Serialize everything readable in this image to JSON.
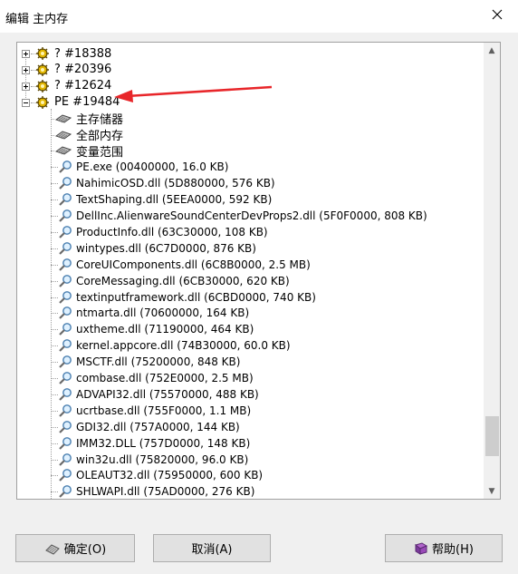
{
  "window": {
    "title": "编辑 主内存"
  },
  "tree": {
    "processes": [
      {
        "label": "? #18388",
        "expanded": false
      },
      {
        "label": "? #20396",
        "expanded": false
      },
      {
        "label": "? #12624",
        "expanded": false
      },
      {
        "label": "PE #19484",
        "expanded": true
      }
    ],
    "memory_regions": [
      "主存储器",
      "全部内存",
      "变量范围"
    ],
    "modules": [
      "PE.exe (00400000, 16.0 KB)",
      "NahimicOSD.dll (5D880000, 576 KB)",
      "TextShaping.dll (5EEA0000, 592 KB)",
      "DellInc.AlienwareSoundCenterDevProps2.dll (5F0F0000, 808 KB)",
      "ProductInfo.dll (63C30000, 108 KB)",
      "wintypes.dll (6C7D0000, 876 KB)",
      "CoreUIComponents.dll (6C8B0000, 2.5 MB)",
      "CoreMessaging.dll (6CB30000, 620 KB)",
      "textinputframework.dll (6CBD0000, 740 KB)",
      "ntmarta.dll (70600000, 164 KB)",
      "uxtheme.dll (71190000, 464 KB)",
      "kernel.appcore.dll (74B30000, 60.0 KB)",
      "MSCTF.dll (75200000, 848 KB)",
      "combase.dll (752E0000, 2.5 MB)",
      "ADVAPI32.dll (75570000, 488 KB)",
      "ucrtbase.dll (755F0000, 1.1 MB)",
      "GDI32.dll (757A0000, 144 KB)",
      "IMM32.DLL (757D0000, 148 KB)",
      "win32u.dll (75820000, 96.0 KB)",
      "OLEAUT32.dll (75950000, 600 KB)",
      "SHLWAPI.dll (75AD0000, 276 KB)"
    ]
  },
  "buttons": {
    "ok": "确定(O)",
    "cancel": "取消(A)",
    "help": "帮助(H)"
  },
  "colors": {
    "arrow": "#e8262a",
    "title_bg": "#ffffff",
    "window_bg": "#f0f0f0"
  }
}
